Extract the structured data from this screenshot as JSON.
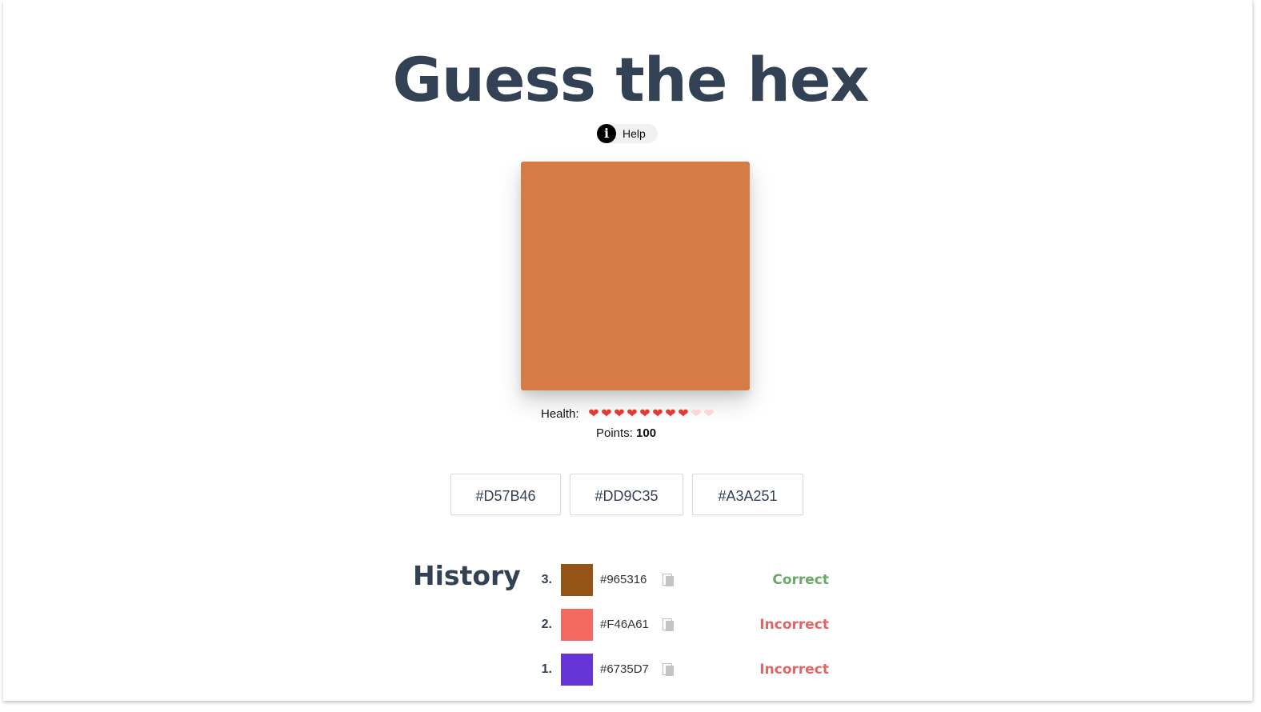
{
  "title": "Guess the hex",
  "help": {
    "icon": "info-icon",
    "icon_glyph": "i",
    "label": "Help"
  },
  "target_color": "#D57B46",
  "health": {
    "label": "Health:",
    "current": 8,
    "max": 10,
    "full_color": "#e53935",
    "empty_color": "#fdd3d3"
  },
  "points": {
    "label": "Points:",
    "value": "100"
  },
  "options": [
    "#D57B46",
    "#DD9C35",
    "#A3A251"
  ],
  "history": {
    "title": "History",
    "items": [
      {
        "number": "3.",
        "color": "#965316",
        "hex": "#965316",
        "status": "Correct",
        "status_color": "#6aa86a"
      },
      {
        "number": "2.",
        "color": "#F46A61",
        "hex": "#F46A61",
        "status": "Incorrect",
        "status_color": "#e06666"
      },
      {
        "number": "1.",
        "color": "#6735D7",
        "hex": "#6735D7",
        "status": "Incorrect",
        "status_color": "#e06666"
      }
    ]
  }
}
